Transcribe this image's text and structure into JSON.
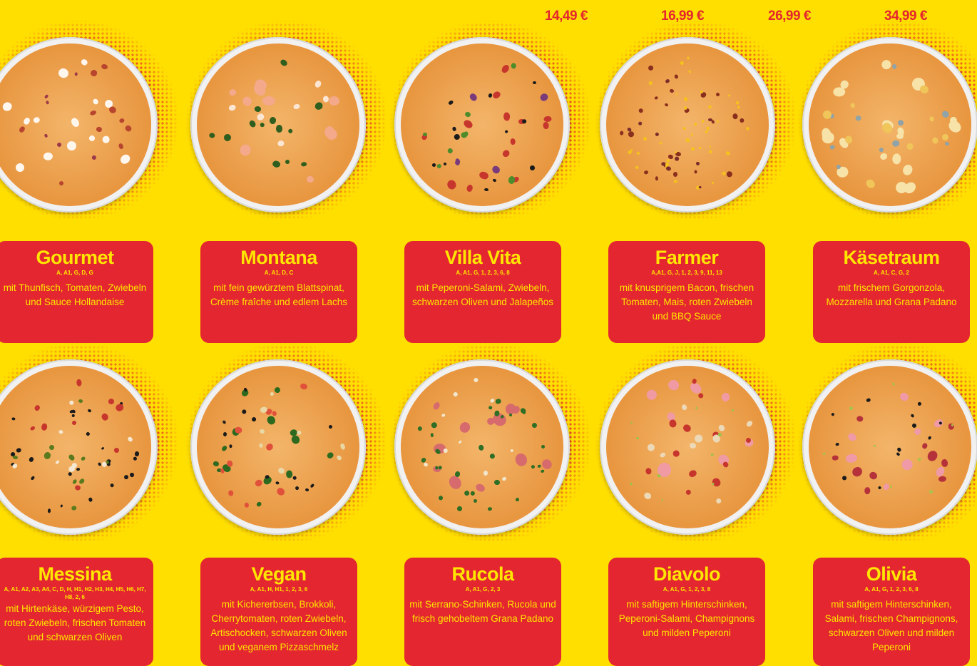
{
  "prices": [
    "14,49 €",
    "16,99 €",
    "26,99 €",
    "34,99 €"
  ],
  "colors": {
    "background": "#ffdf00",
    "card": "#e3262f",
    "text": "#ffe600"
  },
  "pizzas": [
    {
      "name": "Gourmet",
      "allergens": "A, A1, G, D, G",
      "description": "mit Thunfisch, Tomaten, Zwiebeln und Sauce Hollandaise",
      "toppings": "tuna-onion-hollandaise"
    },
    {
      "name": "Montana",
      "allergens": "A, A1, D, C",
      "description": "mit fein gewürztem Blattspinat, Crème fraîche und edlem Lachs",
      "toppings": "spinach-salmon"
    },
    {
      "name": "Villa Vita",
      "allergens": "A, A1, G, 1, 2, 3, 6, 8",
      "description": "mit Peperoni-Salami, Zwiebeln, schwarzen Oliven und Jalapeños",
      "toppings": "salami-olive-jalapeno"
    },
    {
      "name": "Farmer",
      "allergens": "A,A1, G, J, 1, 2, 3, 9, 11, 13",
      "description": "mit knusprigem Bacon, frischen Tomaten, Mais, roten Zwiebeln und BBQ Sauce",
      "toppings": "bacon-corn-bbq"
    },
    {
      "name": "Käsetraum",
      "allergens": "A, A1, C, G, 2",
      "description": "mit frischem Gorgonzola, Mozzarella und Grana Padano",
      "toppings": "cheese"
    },
    {
      "name": "Messina",
      "allergens": "A, A1, A2, A3, A4, C, D, H, H1, H2, H3, H4, H5, H6, H7, H8, 2, 6",
      "description": "mit Hirtenkäse, würzigem Pesto, roten Zwiebeln, frischen Tomaten und schwarzen Oliven",
      "toppings": "feta-pesto-olive"
    },
    {
      "name": "Vegan",
      "allergens": "A, A1, H, H1, 1, 2, 3, 6",
      "description": "mit Kichererbsen, Brokkoli, Cherrytomaten, roten Zwiebeln, Artischocken, schwarzen Oliven und veganem Pizzaschmelz",
      "toppings": "broccoli-olive-tomato"
    },
    {
      "name": "Rucola",
      "allergens": "A, A1, G, 2, 3",
      "description": "mit Serrano-Schinken, Rucola und frisch gehobeltem Grana Padano",
      "toppings": "ham-rocket"
    },
    {
      "name": "Diavolo",
      "allergens": "A, A1, G, 1, 2, 3, 8",
      "description": "mit saftigem Hinterschinken, Peperoni-Salami, Champignons und milden Peperoni",
      "toppings": "ham-salami-mushroom"
    },
    {
      "name": "Olivia",
      "allergens": "A, A1, G, 1, 2, 3, 6, 8",
      "description": "mit saftigem Hinterschinken, Salami, frischen Champignons, schwarzen Oliven und milden Peperoni",
      "toppings": "ham-salami-olive"
    }
  ]
}
